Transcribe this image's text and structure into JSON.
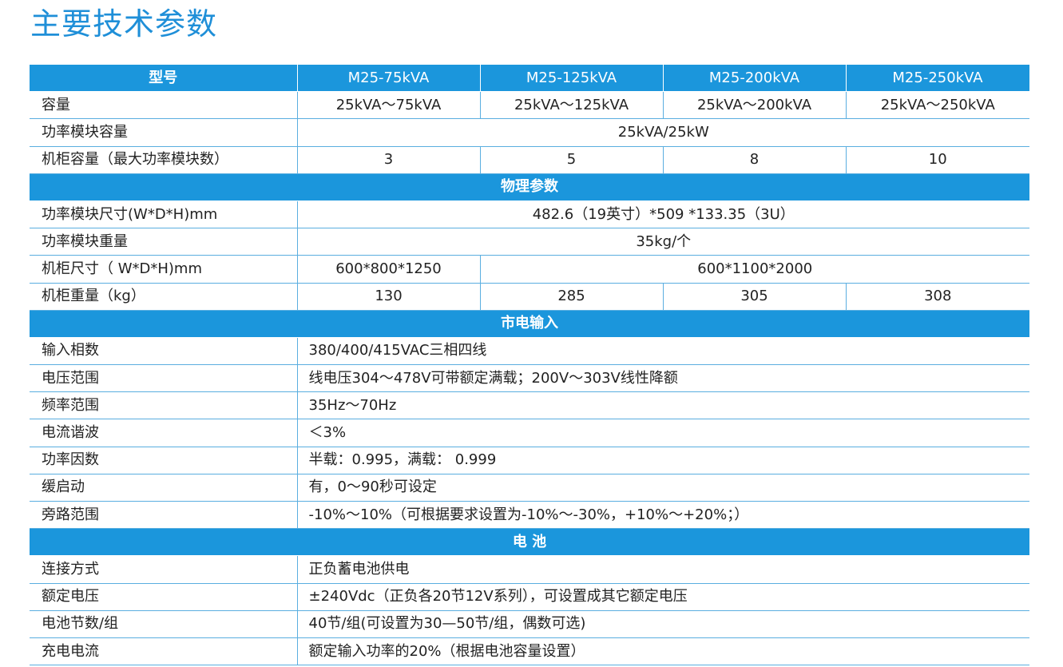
{
  "title": "主要技术参数",
  "header": {
    "label": "型号",
    "models": [
      "M25-75kVA",
      "M25-125kVA",
      "M25-200kVA",
      "M25-250kVA"
    ]
  },
  "general": {
    "capacity": {
      "label": "容量",
      "values": [
        "25kVA～75kVA",
        "25kVA～125kVA",
        "25kVA～200kVA",
        "25kVA～250kVA"
      ]
    },
    "module_capacity": {
      "label": "功率模块容量",
      "value": "25kVA/25kW"
    },
    "cabinet_capacity": {
      "label": "机柜容量（最大功率模块数）",
      "values": [
        "3",
        "5",
        "8",
        "10"
      ]
    }
  },
  "physical": {
    "section": "物理参数",
    "module_size": {
      "label": "功率模块尺寸(W*D*H)mm",
      "value": "482.6（19英寸）*509 *133.35（3U）"
    },
    "module_weight": {
      "label": "功率模块重量",
      "value": "35kg/个"
    },
    "cabinet_size": {
      "label": "机柜尺寸（ W*D*H)mm",
      "value_small": "600*800*1250",
      "value_large": "600*1100*2000"
    },
    "cabinet_weight": {
      "label": "机柜重量（kg）",
      "values": [
        "130",
        "285",
        "305",
        "308"
      ]
    }
  },
  "mains": {
    "section": "市电输入",
    "rows": [
      {
        "label": "输入相数",
        "value": "380/400/415VAC三相四线"
      },
      {
        "label": "电压范围",
        "value": "线电压304～478V可带额定满载；200V～303V线性降额"
      },
      {
        "label": "频率范围",
        "value": "35Hz～70Hz"
      },
      {
        "label": "电流谐波",
        "value": "＜3%"
      },
      {
        "label": "功率因数",
        "value": "半载：0.995，满载： 0.999"
      },
      {
        "label": "缓启动",
        "value": "有，0～90秒可设定"
      },
      {
        "label": "旁路范围",
        "value": "-10%～10%（可根据要求设置为-10%～-30%，+10%～+20%；）"
      }
    ]
  },
  "battery": {
    "section": "电 池",
    "rows": [
      {
        "label": "连接方式",
        "value": "正负蓄电池供电"
      },
      {
        "label": "额定电压",
        "value": "±240Vdc（正负各20节12V系列），可设置成其它额定电压"
      },
      {
        "label": "电池节数/组",
        "value": "40节/组(可设置为30—50节/组，偶数可选)"
      },
      {
        "label": "充电电流",
        "value": "额定输入功率的20%（根据电池容量设置）"
      }
    ]
  }
}
